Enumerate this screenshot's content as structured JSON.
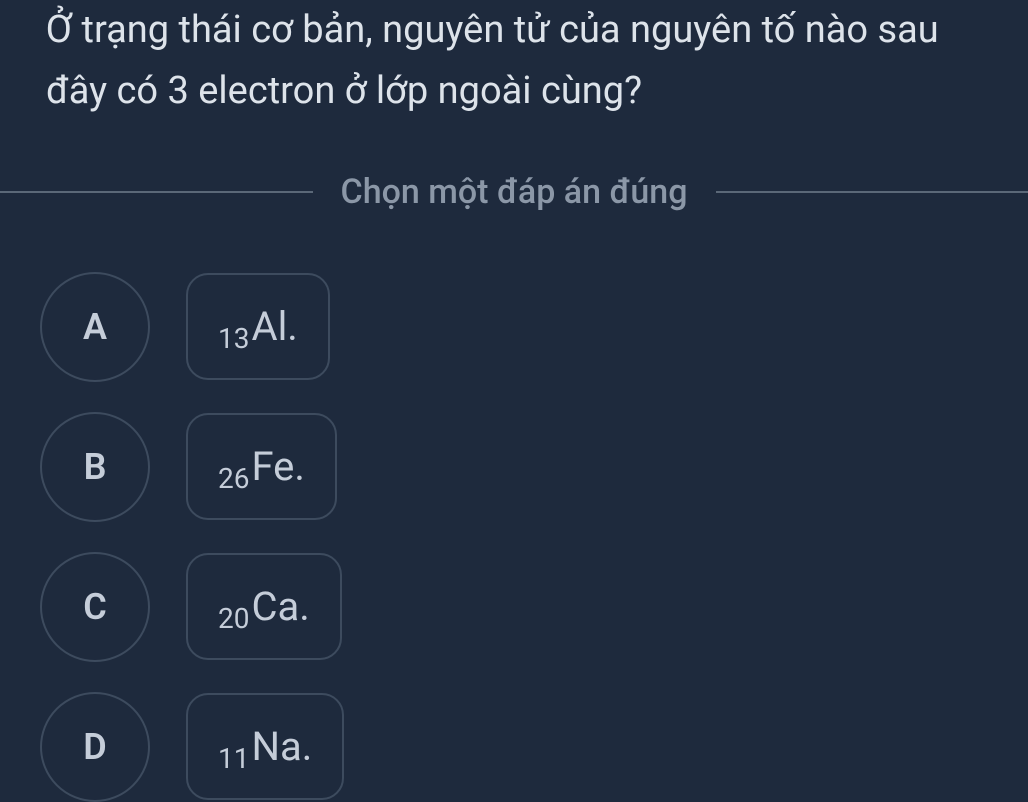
{
  "question": "Ở trạng thái cơ bản, nguyên tử của nguyên tố nào sau đây có 3 electron ở lớp ngoài cùng?",
  "instruction": "Chọn một đáp án đúng",
  "options": [
    {
      "letter": "A",
      "subscript": "13",
      "element": "Al."
    },
    {
      "letter": "B",
      "subscript": "26",
      "element": "Fe."
    },
    {
      "letter": "C",
      "subscript": "20",
      "element": "Ca."
    },
    {
      "letter": "D",
      "subscript": "11",
      "element": "Na."
    }
  ]
}
